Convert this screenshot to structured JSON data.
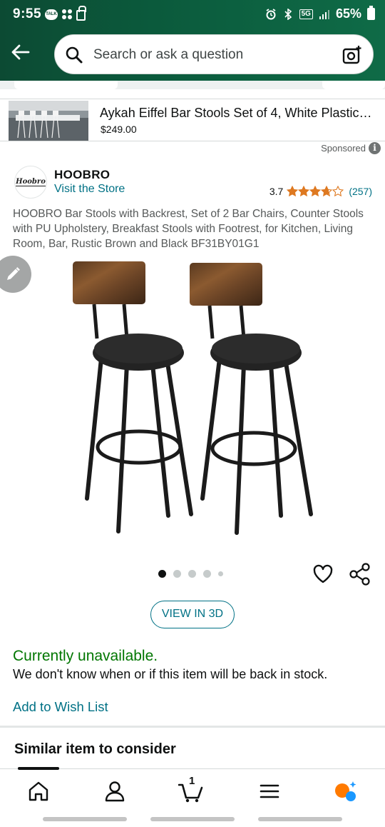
{
  "status_bar": {
    "time": "9:55",
    "talk_badge": "TALK",
    "network": "5G",
    "battery": "65%"
  },
  "search": {
    "placeholder": "Search or ask a question"
  },
  "sponsored_ad": {
    "title": "Aykah Eiffel Bar Stools Set of 4, White Plastic…",
    "price": "$249.00",
    "sponsored_label": "Sponsored",
    "info_glyph": "i"
  },
  "brand": {
    "logo_text": "Hoobro",
    "name": "HOOBRO",
    "visit_store": "Visit the Store"
  },
  "rating": {
    "value": "3.7",
    "stars": 3.7,
    "count": "(257)"
  },
  "product": {
    "title": "HOOBRO Bar Stools with Backrest, Set of 2 Bar Chairs, Counter Stools with PU Upholstery, Breakfast Stools with Footrest, for Kitchen, Living Room, Bar, Rustic Brown and Black BF31BY01G1"
  },
  "carousel": {
    "total_images": 5,
    "active_index": 0
  },
  "view_3d": "VIEW IN 3D",
  "availability": {
    "status": "Currently unavailable.",
    "message": "We don't know when or if this item will be back in stock."
  },
  "wishlist_link": "Add to Wish List",
  "similar_heading": "Similar item to consider",
  "bottom_nav": {
    "cart_count": "1",
    "items": [
      "home-icon",
      "account-icon",
      "cart-icon",
      "menu-icon",
      "rufus-icon"
    ]
  },
  "colors": {
    "header_green": "#0c4a33",
    "link_teal": "#007185",
    "unavailable_green": "#007600",
    "star_orange": "#de7921"
  }
}
